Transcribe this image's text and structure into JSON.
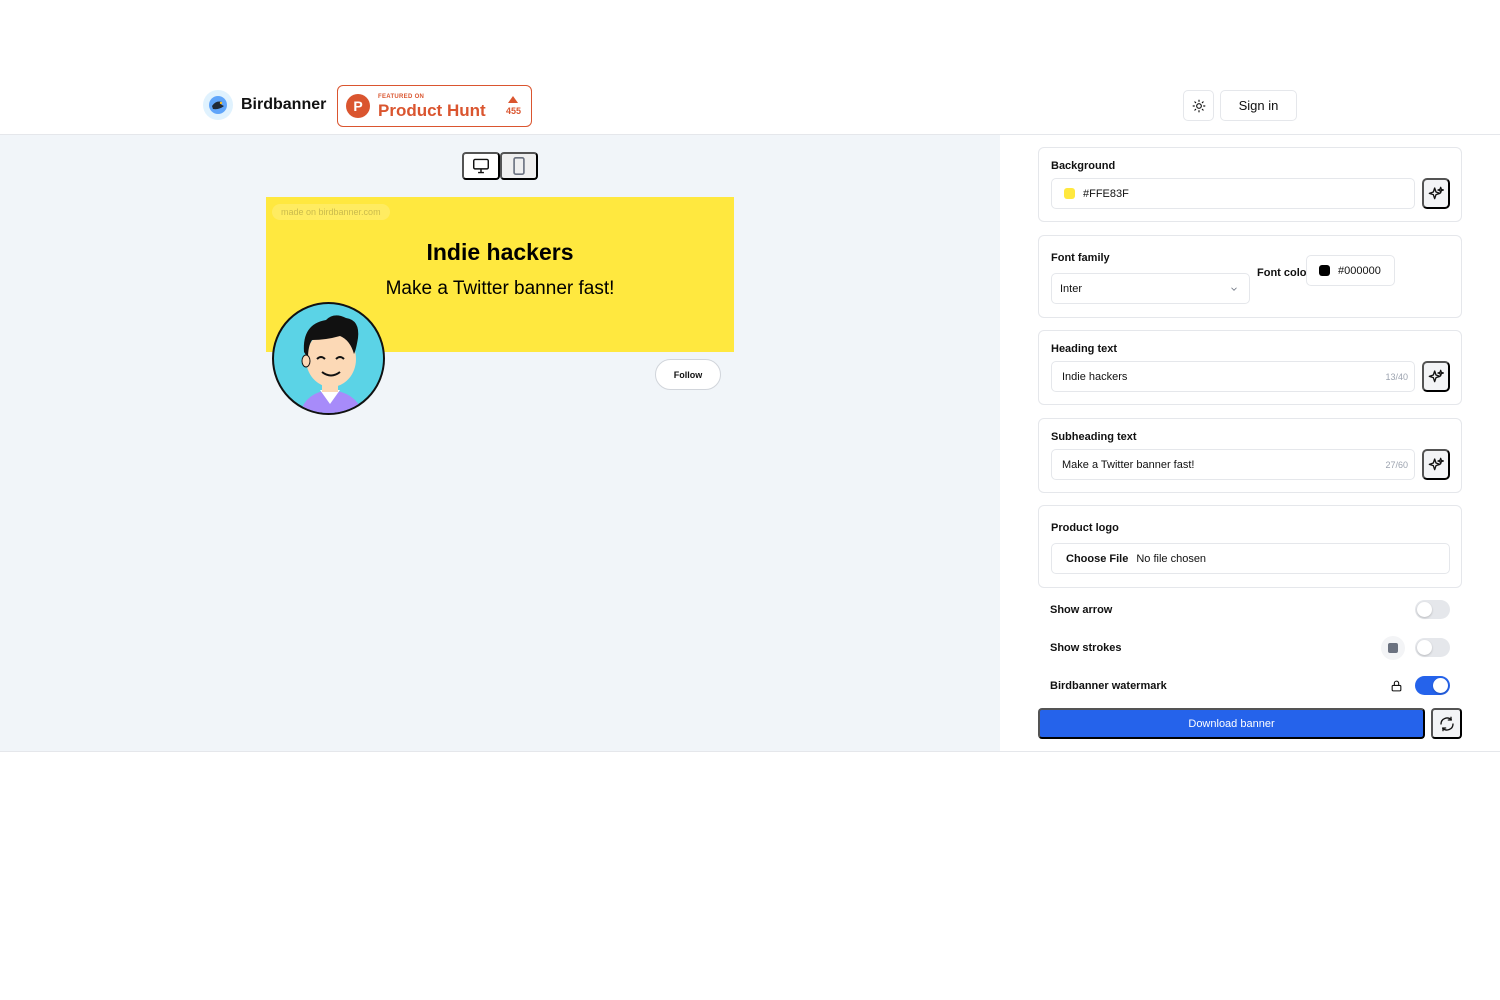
{
  "header": {
    "brand_name": "Birdbanner",
    "product_hunt": {
      "featured_label": "FEATURED ON",
      "name": "Product Hunt",
      "votes": "455"
    },
    "sign_in_label": "Sign in"
  },
  "banner": {
    "watermark": "made on birdbanner.com",
    "heading": "Indie hackers",
    "subheading": "Make a Twitter banner fast!",
    "background_color": "#FFE83F",
    "follow_label": "Follow"
  },
  "panel": {
    "background": {
      "label": "Background",
      "value": "#FFE83F"
    },
    "font_family": {
      "label": "Font family",
      "value": "Inter"
    },
    "font_color": {
      "label": "Font color",
      "value": "#000000"
    },
    "heading_text": {
      "label": "Heading text",
      "value": "Indie hackers",
      "counter": "13/40"
    },
    "subheading_text": {
      "label": "Subheading text",
      "value": "Make a Twitter banner fast!",
      "counter": "27/60"
    },
    "product_logo": {
      "label": "Product logo",
      "choose_file_label": "Choose File",
      "file_status": "No file chosen"
    },
    "show_arrow": {
      "label": "Show arrow",
      "enabled": false
    },
    "show_strokes": {
      "label": "Show strokes",
      "enabled": false
    },
    "watermark_toggle": {
      "label": "Birdbanner watermark",
      "enabled": true
    },
    "download_label": "Download banner"
  },
  "colors": {
    "accent": "#2563eb",
    "product_hunt": "#da552f",
    "banner_bg": "#FFE83F"
  }
}
